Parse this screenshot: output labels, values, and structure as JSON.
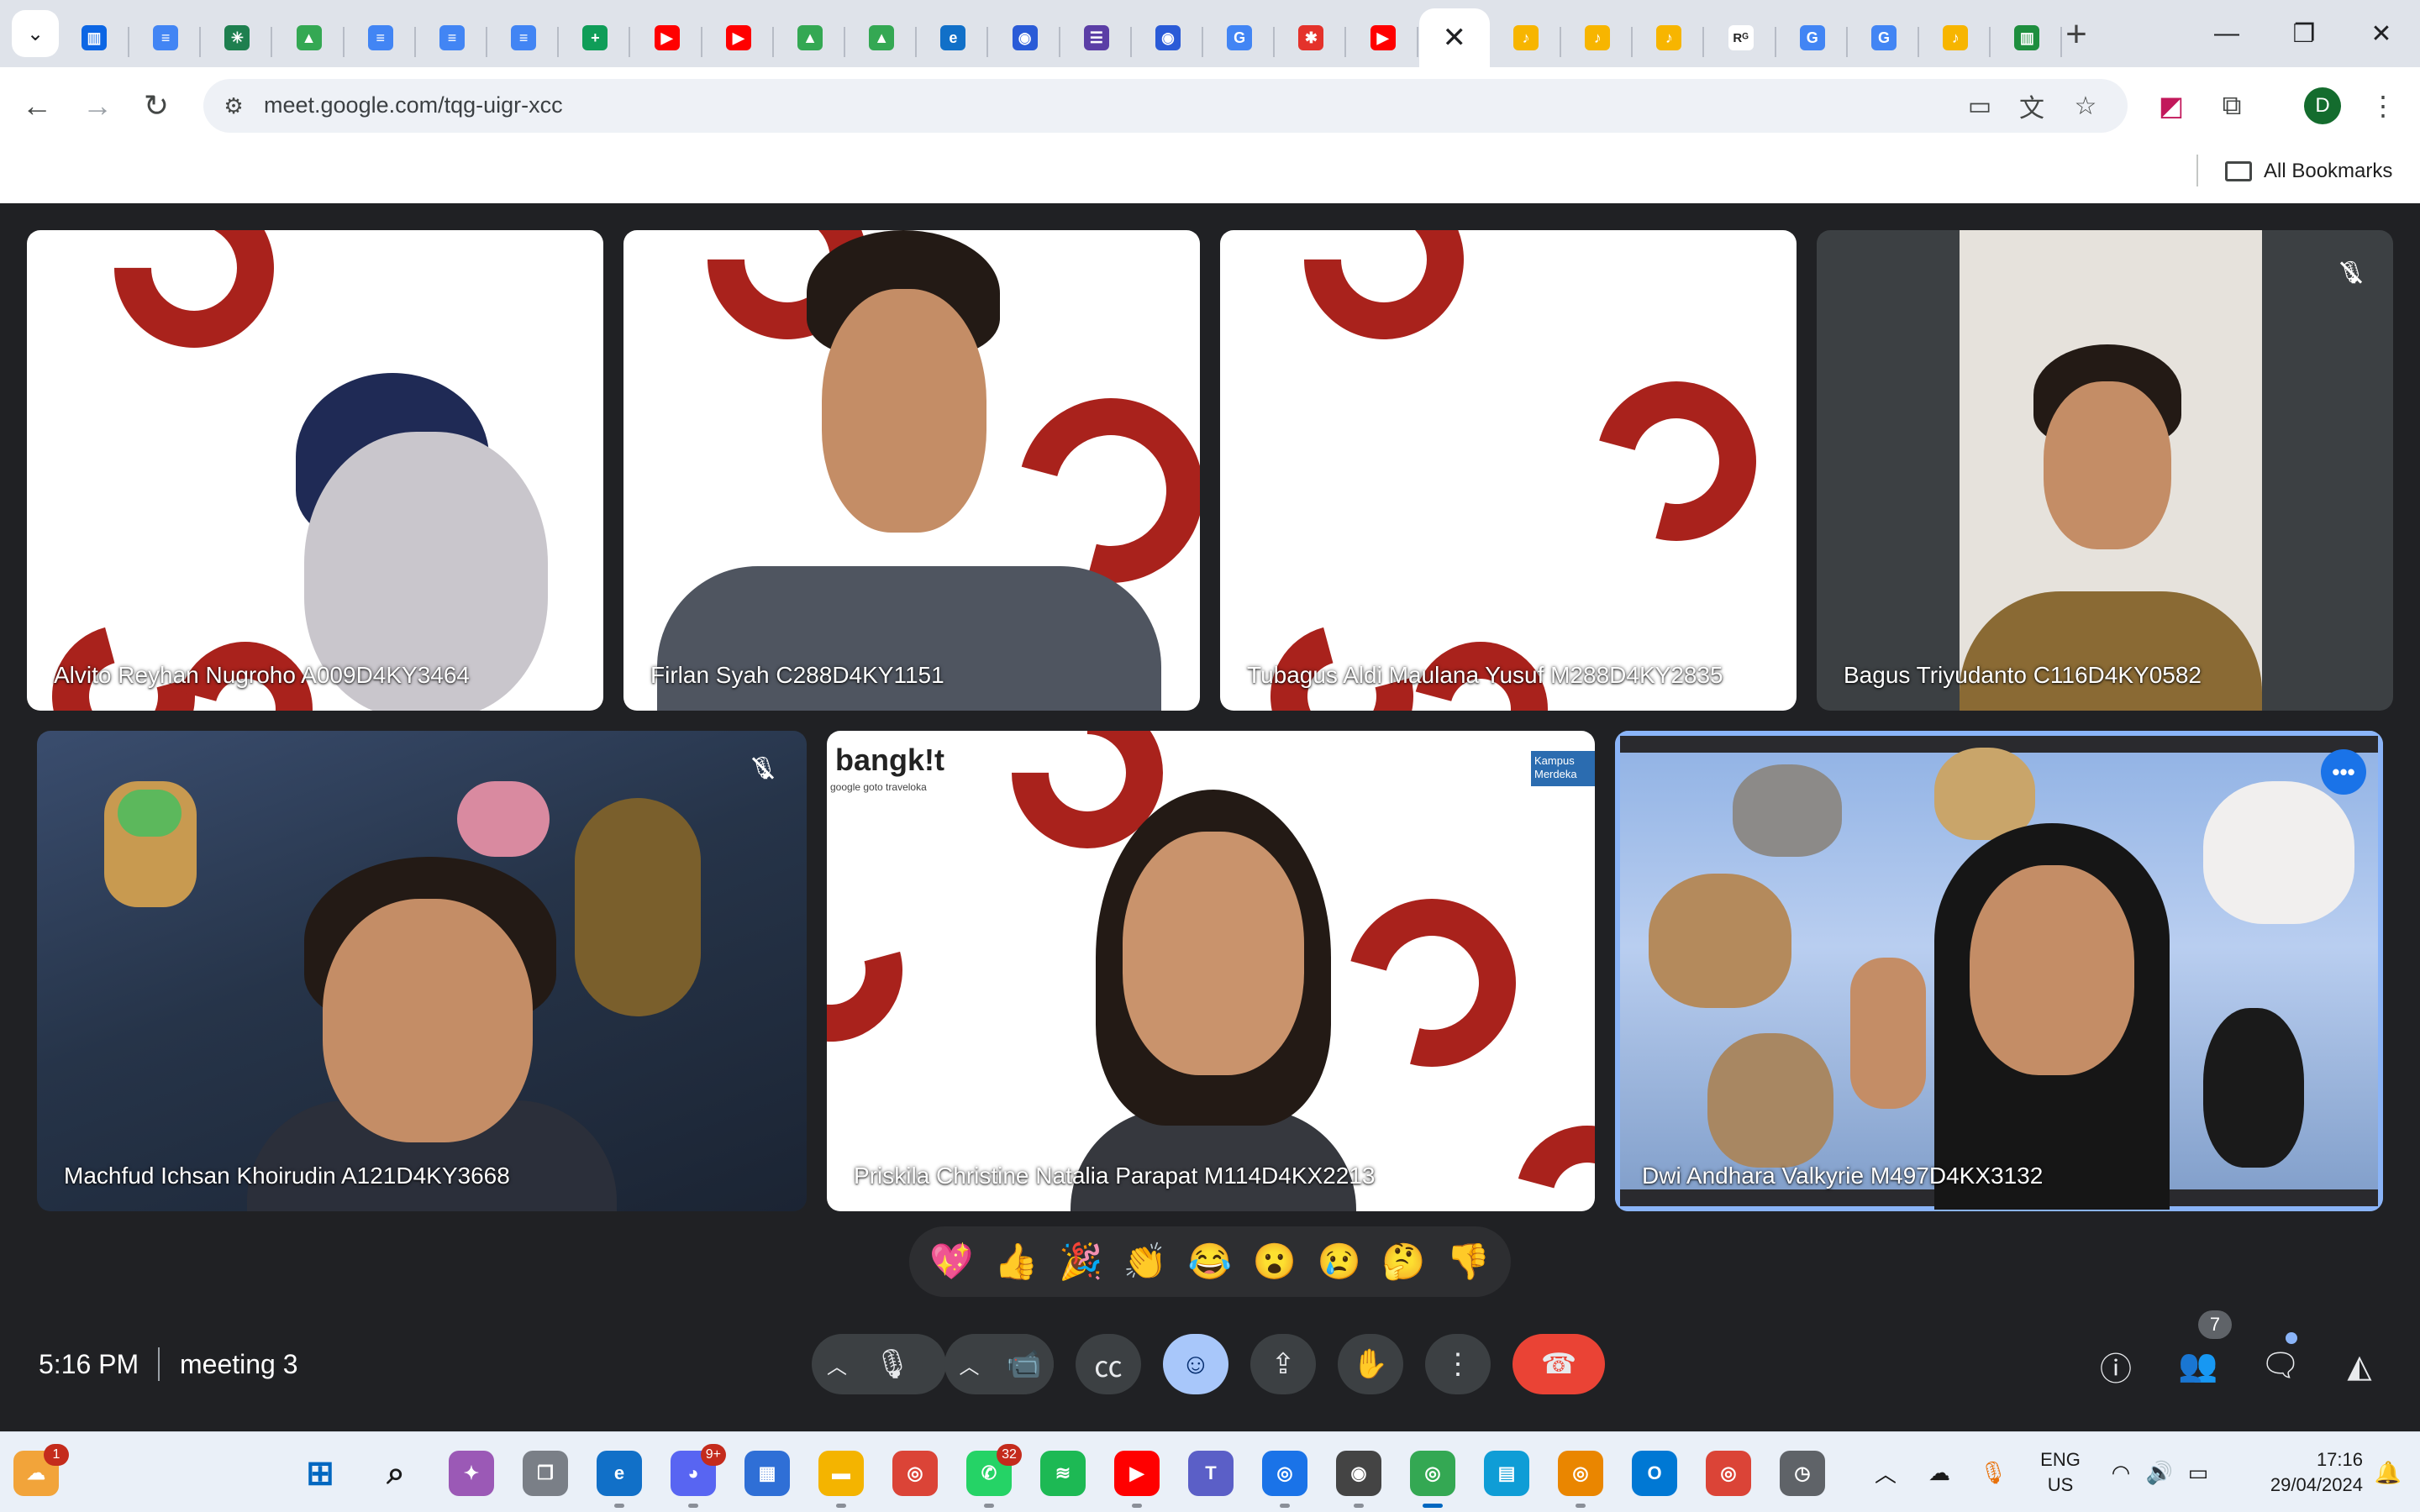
{
  "browser": {
    "tabs": [
      {
        "icon": "trello-icon",
        "color": "#0c66e4",
        "glyph": "▥"
      },
      {
        "icon": "google-docs-icon",
        "color": "#4285f4",
        "glyph": "≡"
      },
      {
        "icon": "perplexity-icon",
        "color": "#1e7f4f",
        "glyph": "✳"
      },
      {
        "icon": "google-drive-icon",
        "color": "#34a853",
        "glyph": "▲"
      },
      {
        "icon": "google-docs-icon",
        "color": "#4285f4",
        "glyph": "≡"
      },
      {
        "icon": "google-docs-icon",
        "color": "#4285f4",
        "glyph": "≡"
      },
      {
        "icon": "google-docs-icon",
        "color": "#4285f4",
        "glyph": "≡"
      },
      {
        "icon": "google-sheets-icon",
        "color": "#0f9d58",
        "glyph": "+"
      },
      {
        "icon": "youtube-icon",
        "color": "#ff0000",
        "glyph": "▶"
      },
      {
        "icon": "youtube-icon",
        "color": "#ff0000",
        "glyph": "▶"
      },
      {
        "icon": "google-drive-icon",
        "color": "#34a853",
        "glyph": "▲"
      },
      {
        "icon": "google-drive-icon",
        "color": "#34a853",
        "glyph": "▲"
      },
      {
        "icon": "edge-icon",
        "color": "#1170c8",
        "glyph": "e"
      },
      {
        "icon": "copilot-icon",
        "color": "#2a5bd7",
        "glyph": "◉"
      },
      {
        "icon": "forms-icon",
        "color": "#5b3ea6",
        "glyph": "☰"
      },
      {
        "icon": "copilot-icon",
        "color": "#2a5bd7",
        "glyph": "◉"
      },
      {
        "icon": "google-icon",
        "color": "#4285f4",
        "glyph": "G"
      },
      {
        "icon": "asterisk-icon",
        "color": "#e4322b",
        "glyph": "✱"
      },
      {
        "icon": "youtube-icon",
        "color": "#ff0000",
        "glyph": "▶"
      },
      {
        "icon": "close-icon",
        "color": "#ffffff",
        "glyph": "✕",
        "active": true
      },
      {
        "icon": "music-note-icon",
        "color": "#f7b500",
        "glyph": "♪"
      },
      {
        "icon": "music-note-icon",
        "color": "#f7b500",
        "glyph": "♪"
      },
      {
        "icon": "music-note-icon",
        "color": "#f7b500",
        "glyph": "♪"
      },
      {
        "icon": "researchgate-icon",
        "color": "#ffffff",
        "glyph": "Rᴳ"
      },
      {
        "icon": "google-icon",
        "color": "#4285f4",
        "glyph": "G"
      },
      {
        "icon": "google-icon",
        "color": "#4285f4",
        "glyph": "G"
      },
      {
        "icon": "music-note-icon",
        "color": "#f7b500",
        "glyph": "♪"
      },
      {
        "icon": "trello-icon",
        "color": "#1e8e3e",
        "glyph": "▥"
      }
    ],
    "url": "meet.google.com/tqg-uigr-xcc",
    "profile_initial": "D",
    "bookmarks_label": "All Bookmarks"
  },
  "meeting": {
    "participants": [
      {
        "name": "Alvito Reyhan Nugroho A009D4KY3464"
      },
      {
        "name": "Firlan Syah C288D4KY1151"
      },
      {
        "name": "Tubagus Aldi Maulana Yusuf M288D4KY2835"
      },
      {
        "name": "Bagus Triyudanto C116D4KY0582",
        "muted": true
      },
      {
        "name": "Machfud Ichsan Khoirudin A121D4KY3668",
        "muted": true
      },
      {
        "name": "Priskila Christine Natalia Parapat M114D4KX2213"
      },
      {
        "name": "Dwi Andhara Valkyrie M497D4KX3132",
        "speaking": true
      }
    ],
    "bangkit_logo": "bangk!t",
    "bangkit_sub": "google  goto  traveloka",
    "kampus_logo": "Kampus Merdeka",
    "reactions": [
      "💖",
      "👍",
      "🎉",
      "👏",
      "😂",
      "😮",
      "😢",
      "🤔",
      "👎"
    ],
    "time": "5:16 PM",
    "name": "meeting 3",
    "people_count": "7"
  },
  "taskbar": {
    "weather_badge": "1",
    "discord_badge": "9+",
    "whatsapp_badge": "32",
    "language_top": "ENG",
    "language_bottom": "US",
    "clock_time": "17:16",
    "clock_date": "29/04/2024"
  },
  "colors": {
    "meet_background": "#202124",
    "brand_red": "#a9221c",
    "leave_red": "#ea4335",
    "accent_blue": "#8ab4f8"
  }
}
